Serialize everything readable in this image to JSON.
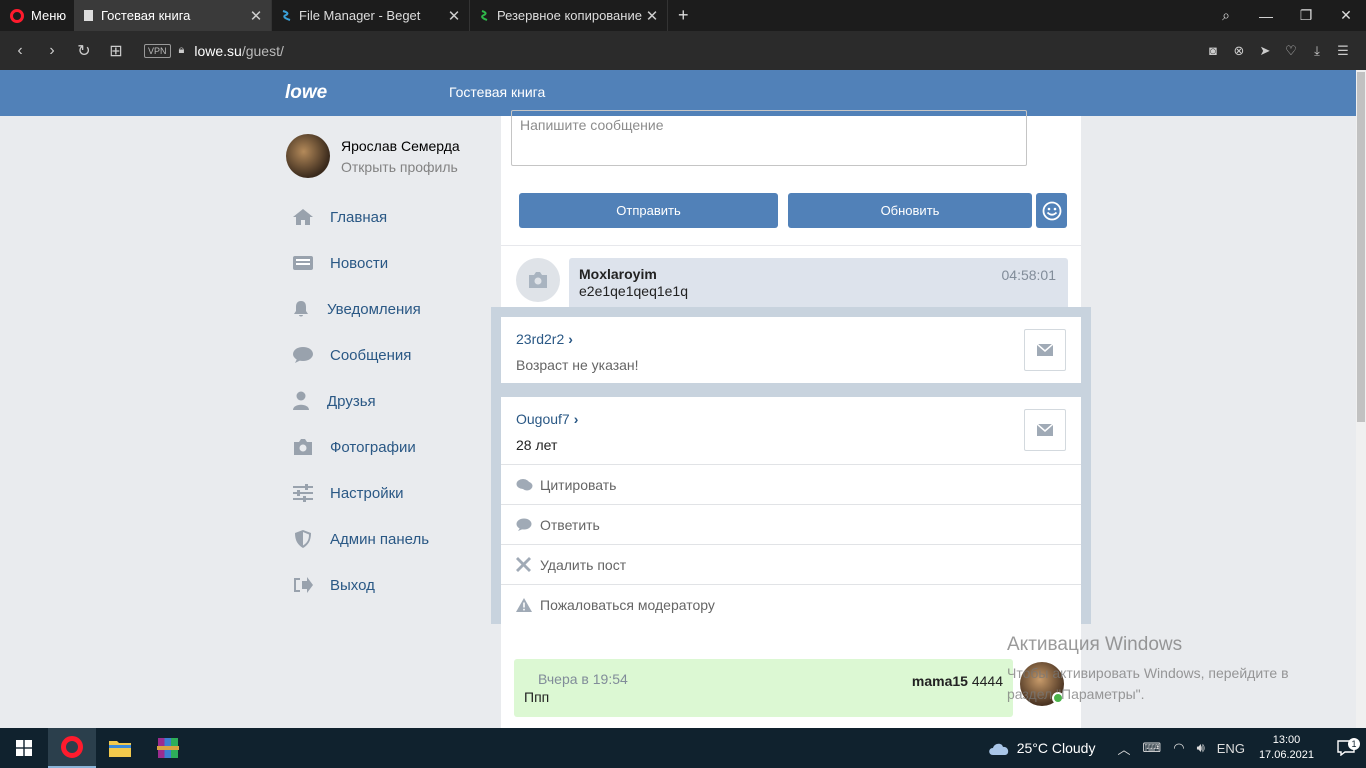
{
  "browser": {
    "menu_label": "Меню",
    "tabs": [
      {
        "title": "Гостевая книга",
        "favicon": "page-icon",
        "active": true
      },
      {
        "title": "File Manager - Beget",
        "favicon": "beget-icon",
        "active": false
      },
      {
        "title": "Резервное копирование |",
        "favicon": "beget-green-icon",
        "active": false
      }
    ],
    "vpn_label": "VPN",
    "url_host": "lowe.su",
    "url_path": "/guest/"
  },
  "site": {
    "logo": "lowe",
    "header_title": "Гостевая книга",
    "accent_color": "#5181b8"
  },
  "profile": {
    "name": "Ярослав Семерда",
    "link": "Открыть профиль"
  },
  "nav": {
    "items": [
      {
        "label": "Главная",
        "icon": "home-icon"
      },
      {
        "label": "Новости",
        "icon": "news-icon"
      },
      {
        "label": "Уведомления",
        "icon": "bell-icon"
      },
      {
        "label": "Сообщения",
        "icon": "chat-icon"
      },
      {
        "label": "Друзья",
        "icon": "user-icon"
      },
      {
        "label": "Фотографии",
        "icon": "camera-icon"
      },
      {
        "label": "Настройки",
        "icon": "sliders-icon"
      },
      {
        "label": "Админ панель",
        "icon": "shield-icon"
      },
      {
        "label": "Выход",
        "icon": "logout-icon"
      }
    ]
  },
  "composer": {
    "placeholder": "Напишите сообщение",
    "send_label": "Отправить",
    "refresh_label": "Обновить"
  },
  "posts": [
    {
      "author": "Moxlaroyim",
      "text": "e2e1qe1qeq1e1q",
      "time": "04:58:01"
    },
    {
      "author": "mama15",
      "author_suffix": "4444",
      "text": "Ппп",
      "time": "Вчера в 19:54"
    }
  ],
  "popup": {
    "card1": {
      "user": "23rd2r2",
      "sub": "Возраст не указан!"
    },
    "card2": {
      "user": "Ougouf7",
      "sub": "28 лет"
    },
    "actions": [
      {
        "label": "Цитировать",
        "icon": "quote-icon"
      },
      {
        "label": "Ответить",
        "icon": "reply-icon"
      },
      {
        "label": "Удалить пост",
        "icon": "delete-icon"
      },
      {
        "label": "Пожаловаться модератору",
        "icon": "warning-icon"
      }
    ]
  },
  "watermark": {
    "title": "Активация Windows",
    "text": "Чтобы активировать Windows, перейдите в раздел \"Параметры\"."
  },
  "taskbar": {
    "weather": "25°C  Cloudy",
    "lang": "ENG",
    "time": "13:00",
    "date": "17.06.2021",
    "notification_count": "1"
  }
}
